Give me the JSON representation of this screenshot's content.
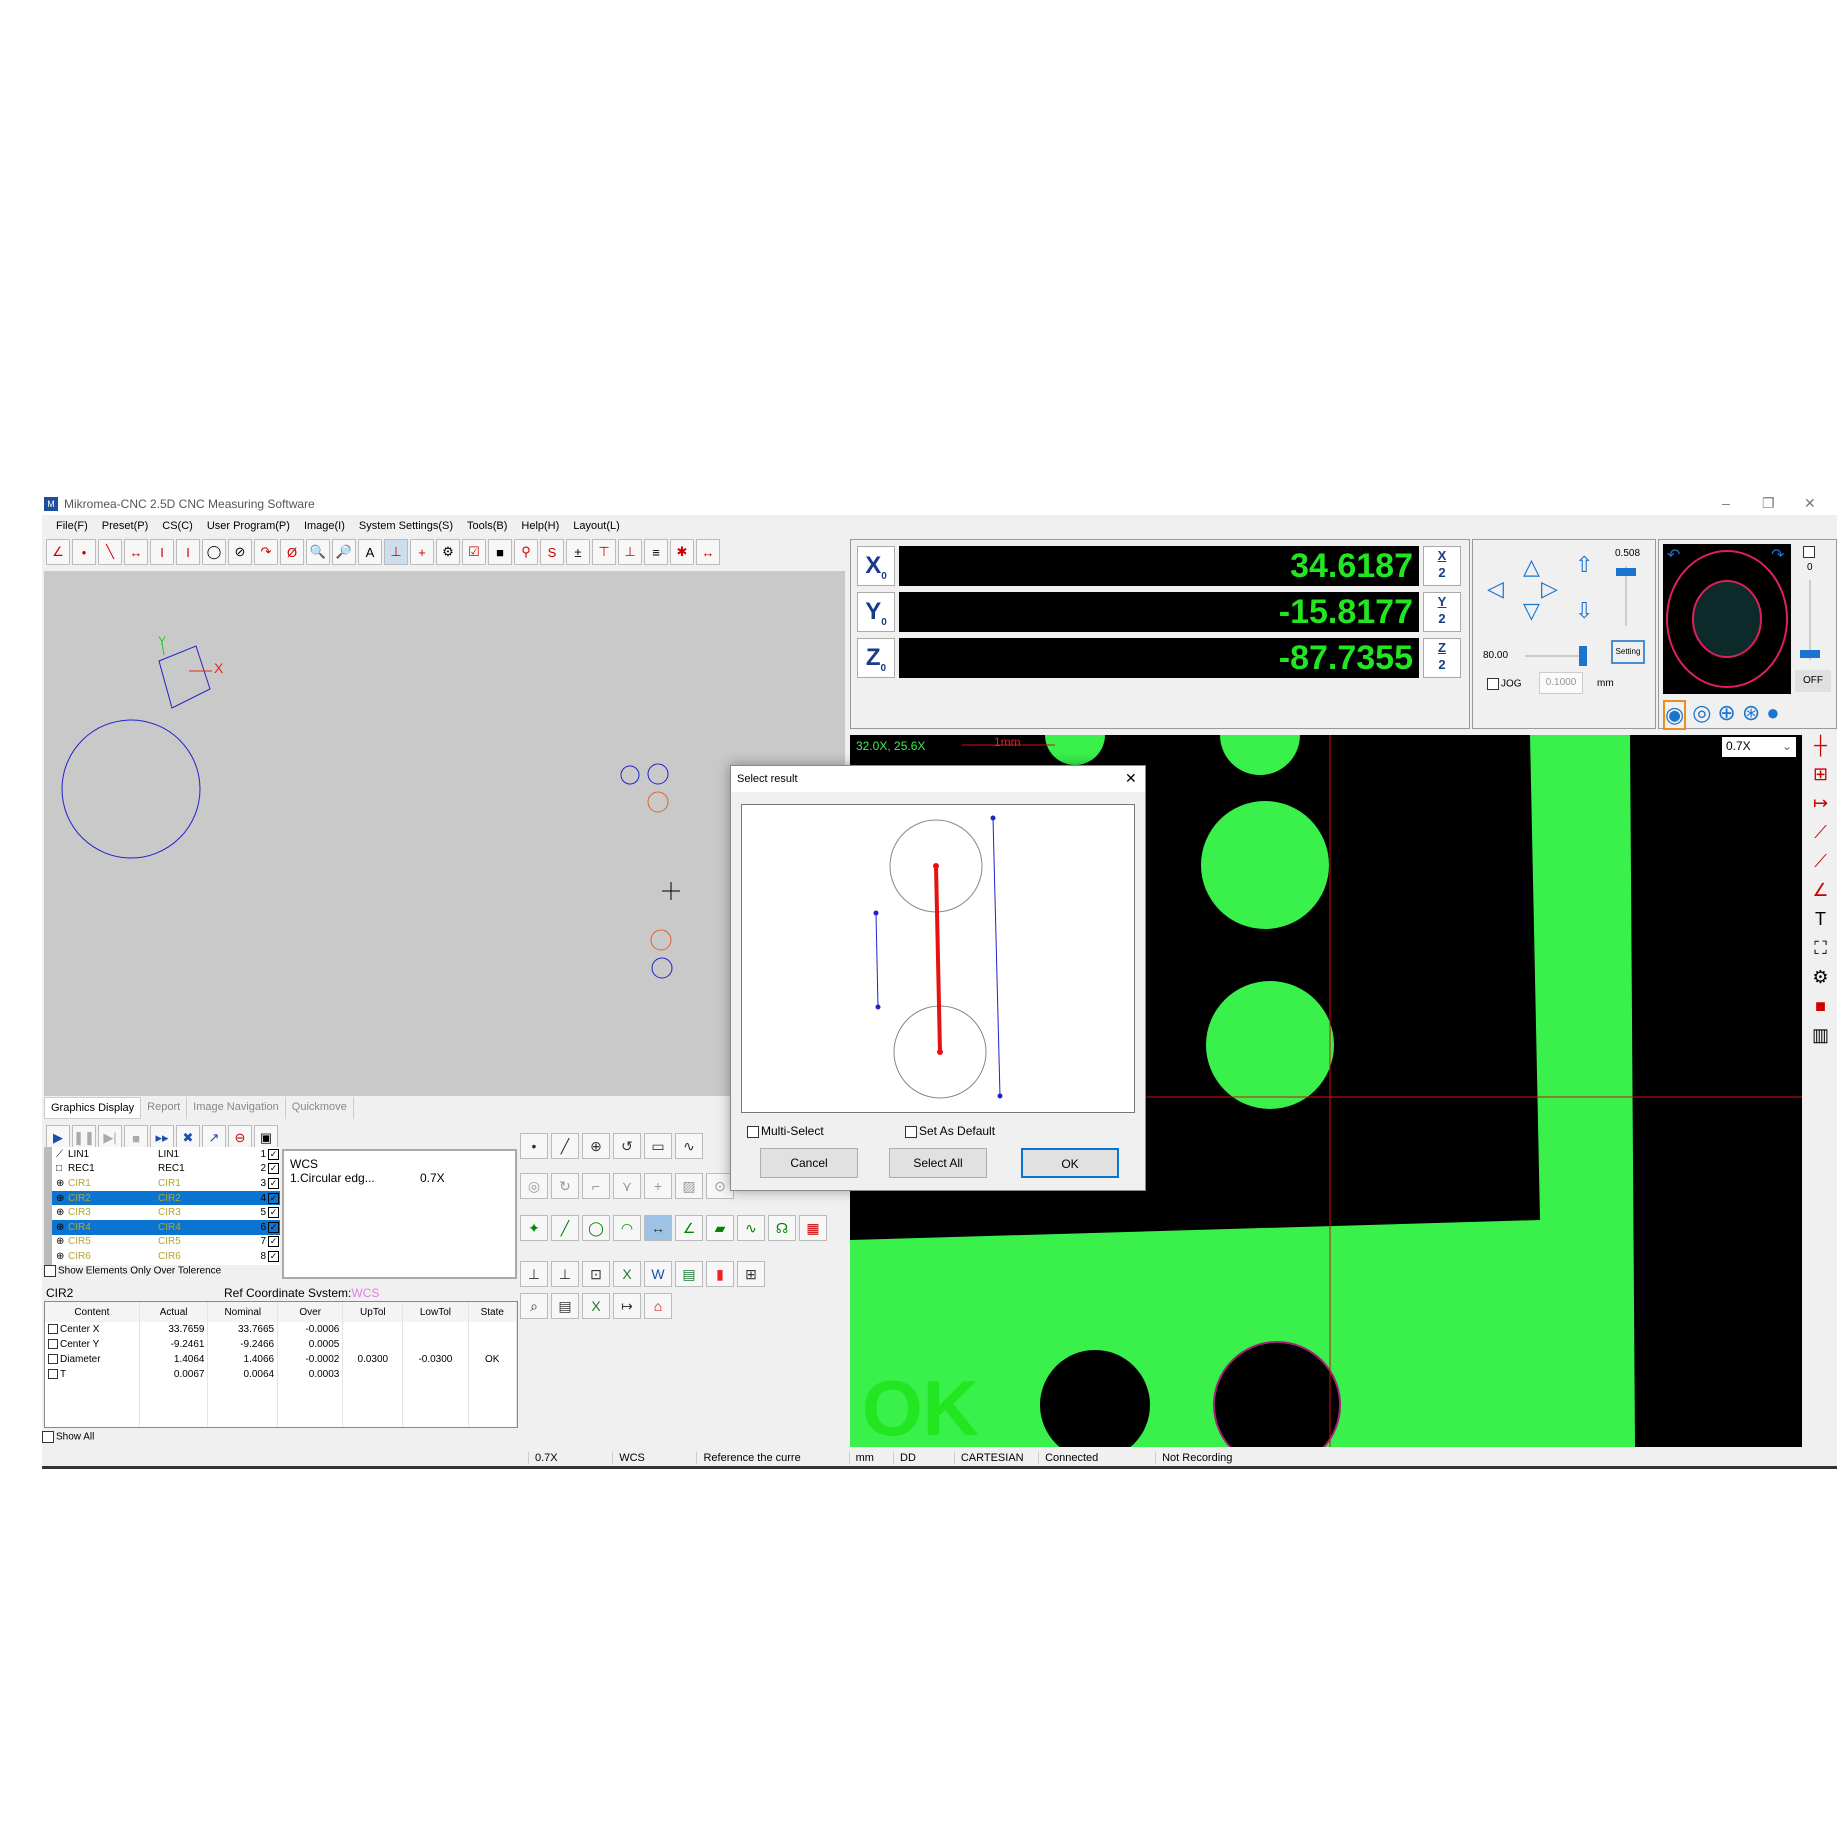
{
  "window": {
    "title": "Mikromea-CNC 2.5D CNC Measuring Software"
  },
  "menu": [
    "File(F)",
    "Preset(P)",
    "CS(C)",
    "User Program(P)",
    "Image(I)",
    "System Settings(S)",
    "Tools(B)",
    "Help(H)",
    "Layout(L)"
  ],
  "tabs": [
    "Graphics Display",
    "Report",
    "Image Navigation",
    "Quickmove"
  ],
  "dro": {
    "x_label": "X",
    "y_label": "Y",
    "z_label": "Z",
    "x": "34.6187",
    "y": "-15.8177",
    "z": "-87.7355",
    "x_half": "X",
    "y_half": "Y",
    "z_half": "Z",
    "half_denom": "2",
    "sub": "0"
  },
  "jog": {
    "speed_value": "0.508",
    "speed2": "80.00",
    "setting_label": "Setting",
    "jog_label": "JOG",
    "step": "0.1000",
    "unit": "mm"
  },
  "light": {
    "value": "0",
    "off_label": "OFF"
  },
  "camera": {
    "magnification": "32.0X, 25.6X",
    "scale_label": "1mm",
    "zoom_select": "0.7X",
    "result_text": "OK"
  },
  "elements": [
    {
      "name": "LIN1",
      "label": "LIN1",
      "idx": "1",
      "icon": "line-icon",
      "selected": false
    },
    {
      "name": "REC1",
      "label": "REC1",
      "idx": "2",
      "icon": "rectangle-icon",
      "selected": false
    },
    {
      "name": "CIR1",
      "label": "CIR1",
      "idx": "3",
      "icon": "circle-icon",
      "selected": false
    },
    {
      "name": "CIR2",
      "label": "CIR2",
      "idx": "4",
      "icon": "circle-icon",
      "selected": true
    },
    {
      "name": "CIR3",
      "label": "CIR3",
      "idx": "5",
      "icon": "circle-icon",
      "selected": false
    },
    {
      "name": "CIR4",
      "label": "CIR4",
      "idx": "6",
      "icon": "circle-icon",
      "selected": true
    },
    {
      "name": "CIR5",
      "label": "CIR5",
      "idx": "7",
      "icon": "circle-icon",
      "selected": false
    },
    {
      "name": "CIR6",
      "label": "CIR6",
      "idx": "8",
      "icon": "circle-icon",
      "selected": false
    }
  ],
  "steps": {
    "cs": "WCS",
    "item": "1.Circular edg...",
    "mag": "0.7X"
  },
  "show_over_tol": "Show Elements Only Over Tolerence",
  "result": {
    "element": "CIR2",
    "ref_label": "Ref Coordinate Svstem:",
    "ref_value": "WCS",
    "columns": [
      "Content",
      "Actual",
      "Nominal",
      "Over",
      "UpTol",
      "LowTol",
      "State"
    ],
    "rows": [
      [
        "Center X",
        "33.7659",
        "33.7665",
        "-0.0006",
        "",
        "",
        ""
      ],
      [
        "Center Y",
        "-9.2461",
        "-9.2466",
        "0.0005",
        "",
        "",
        ""
      ],
      [
        "Diameter",
        "1.4064",
        "1.4066",
        "-0.0002",
        "0.0300",
        "-0.0300",
        "OK"
      ],
      [
        "T",
        "0.0067",
        "0.0064",
        "0.0003",
        "",
        "",
        ""
      ]
    ]
  },
  "show_all": "Show All",
  "dialog": {
    "title": "Select result",
    "multi_select": "Multi-Select",
    "set_default": "Set As Default",
    "cancel": "Cancel",
    "select_all": "Select All",
    "ok": "OK"
  },
  "status": [
    "0.7X",
    "WCS",
    "Reference the curre",
    "mm",
    "DD",
    "CARTESIAN",
    "Connected",
    "Not Recording"
  ],
  "colors": {
    "dro_text": "#22e622",
    "selection": "#0a74d0",
    "camera_feature": "#3af04a"
  }
}
